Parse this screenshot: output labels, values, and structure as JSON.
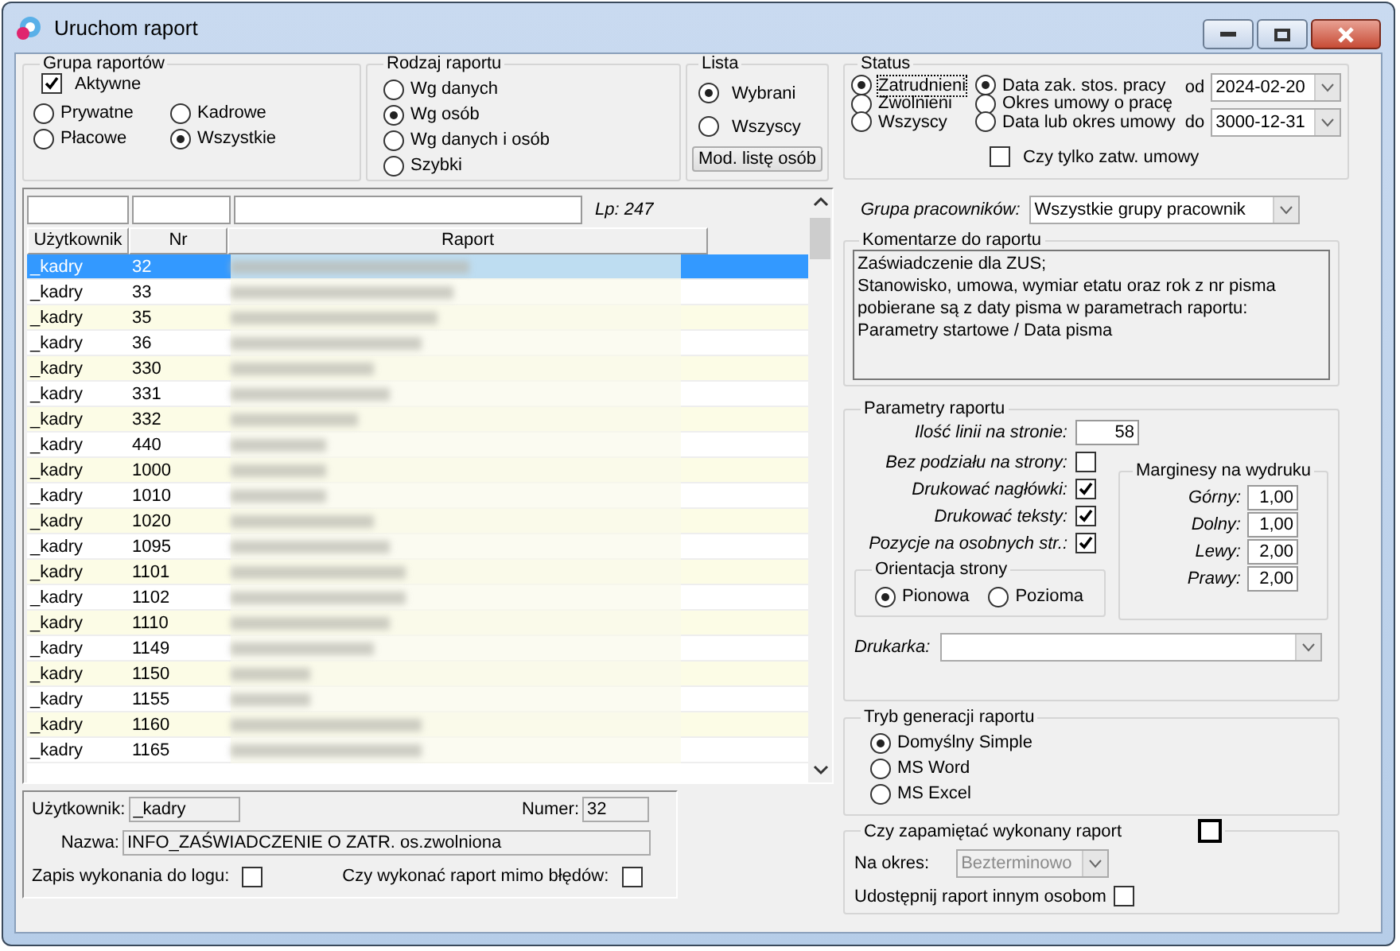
{
  "window": {
    "title": "Uruchom raport"
  },
  "grupa_raportow": {
    "legend": "Grupa raportów",
    "aktywne": {
      "label": "Aktywne",
      "checked": true
    },
    "options": [
      {
        "label": "Prywatne",
        "selected": false
      },
      {
        "label": "Kadrowe",
        "selected": false
      },
      {
        "label": "Płacowe",
        "selected": false
      },
      {
        "label": "Wszystkie",
        "selected": true
      }
    ]
  },
  "rodzaj_raportu": {
    "legend": "Rodzaj raportu",
    "options": [
      {
        "label": "Wg danych",
        "selected": false
      },
      {
        "label": "Wg osób",
        "selected": true
      },
      {
        "label": "Wg danych i osób",
        "selected": false
      },
      {
        "label": "Szybki",
        "selected": false
      }
    ]
  },
  "lista": {
    "legend": "Lista",
    "options": [
      {
        "label": "Wybrani",
        "selected": true
      },
      {
        "label": "Wszyscy",
        "selected": false
      }
    ],
    "button": "Mod. listę osób"
  },
  "status": {
    "legend": "Status",
    "options": [
      {
        "label": "Zatrudnieni",
        "selected": true
      },
      {
        "label": "Zwolnieni",
        "selected": false
      },
      {
        "label": "Wszyscy",
        "selected": false
      }
    ],
    "date_options": [
      {
        "label": "Data zak. stos. pracy",
        "selected": true
      },
      {
        "label": "Okres umowy o pracę",
        "selected": false
      },
      {
        "label": "Data lub okres umowy",
        "selected": false
      }
    ],
    "od": {
      "label": "od",
      "value": "2024-02-20"
    },
    "do": {
      "label": "do",
      "value": "3000-12-31"
    },
    "tylko_zatw": {
      "label": "Czy tylko zatw. umowy",
      "checked": false
    }
  },
  "report_list": {
    "count": "Lp: 247",
    "columns": [
      "Użytkownik",
      "Nr",
      "Raport"
    ],
    "rows": [
      {
        "user": "_kadry",
        "nr": "32",
        "selected": true
      },
      {
        "user": "_kadry",
        "nr": "33",
        "selected": false
      },
      {
        "user": "_kadry",
        "nr": "35",
        "selected": false
      },
      {
        "user": "_kadry",
        "nr": "36",
        "selected": false
      },
      {
        "user": "_kadry",
        "nr": "330",
        "selected": false
      },
      {
        "user": "_kadry",
        "nr": "331",
        "selected": false
      },
      {
        "user": "_kadry",
        "nr": "332",
        "selected": false
      },
      {
        "user": "_kadry",
        "nr": "440",
        "selected": false
      },
      {
        "user": "_kadry",
        "nr": "1000",
        "selected": false
      },
      {
        "user": "_kadry",
        "nr": "1010",
        "selected": false
      },
      {
        "user": "_kadry",
        "nr": "1020",
        "selected": false
      },
      {
        "user": "_kadry",
        "nr": "1095",
        "selected": false
      },
      {
        "user": "_kadry",
        "nr": "1101",
        "selected": false
      },
      {
        "user": "_kadry",
        "nr": "1102",
        "selected": false
      },
      {
        "user": "_kadry",
        "nr": "1110",
        "selected": false
      },
      {
        "user": "_kadry",
        "nr": "1149",
        "selected": false
      },
      {
        "user": "_kadry",
        "nr": "1150",
        "selected": false
      },
      {
        "user": "_kadry",
        "nr": "1155",
        "selected": false
      },
      {
        "user": "_kadry",
        "nr": "1160",
        "selected": false
      },
      {
        "user": "_kadry",
        "nr": "1165",
        "selected": false
      }
    ]
  },
  "details": {
    "user_label": "Użytkownik:",
    "user_value": "_kadry",
    "numer_label": "Numer:",
    "numer_value": "32",
    "nazwa_label": "Nazwa:",
    "nazwa_value": "INFO_ZAŚWIADCZENIE O ZATR. os.zwolniona",
    "zapis_logu": {
      "label": "Zapis wykonania do logu:",
      "checked": false
    },
    "mimo_bledow": {
      "label": "Czy wykonać raport mimo błędów:",
      "checked": false
    }
  },
  "grupa_pracownikow": {
    "label": "Grupa pracowników:",
    "value": "Wszystkie grupy pracownik"
  },
  "komentarze": {
    "legend": "Komentarze do raportu",
    "text": "Zaświadczenie dla ZUS;\nStanowisko, umowa, wymiar etatu oraz rok z nr pisma\npobierane są z daty pisma w parametrach raportu:\nParametry startowe / Data pisma"
  },
  "parametry": {
    "legend": "Parametry raportu",
    "linie": {
      "label": "Ilość linii na stronie:",
      "value": "58"
    },
    "checks": [
      {
        "label": "Bez podziału na strony:",
        "checked": false
      },
      {
        "label": "Drukować nagłówki:",
        "checked": true
      },
      {
        "label": "Drukować teksty:",
        "checked": true
      },
      {
        "label": "Pozycje na osobnych str.:",
        "checked": true
      }
    ],
    "orientacja": {
      "legend": "Orientacja strony",
      "options": [
        {
          "label": "Pionowa",
          "selected": true
        },
        {
          "label": "Pozioma",
          "selected": false
        }
      ]
    },
    "marginesy": {
      "legend": "Marginesy na wydruku",
      "fields": [
        {
          "label": "Górny:",
          "value": "1,00"
        },
        {
          "label": "Dolny:",
          "value": "1,00"
        },
        {
          "label": "Lewy:",
          "value": "2,00"
        },
        {
          "label": "Prawy:",
          "value": "2,00"
        }
      ]
    },
    "drukarka": {
      "label": "Drukarka:"
    }
  },
  "tryb": {
    "legend": "Tryb generacji raportu",
    "options": [
      {
        "label": "Domyślny Simple",
        "selected": true
      },
      {
        "label": "MS Word",
        "selected": false
      },
      {
        "label": "MS Excel",
        "selected": false
      }
    ]
  },
  "zapamietac": {
    "legend": "Czy zapamiętać wykonany raport",
    "checked": false,
    "okres_label": "Na okres:",
    "okres_value": "Bezterminowo",
    "okres_disabled": true,
    "udostepnij": {
      "label": "Udostępnij raport innym osobom",
      "checked": false
    }
  }
}
